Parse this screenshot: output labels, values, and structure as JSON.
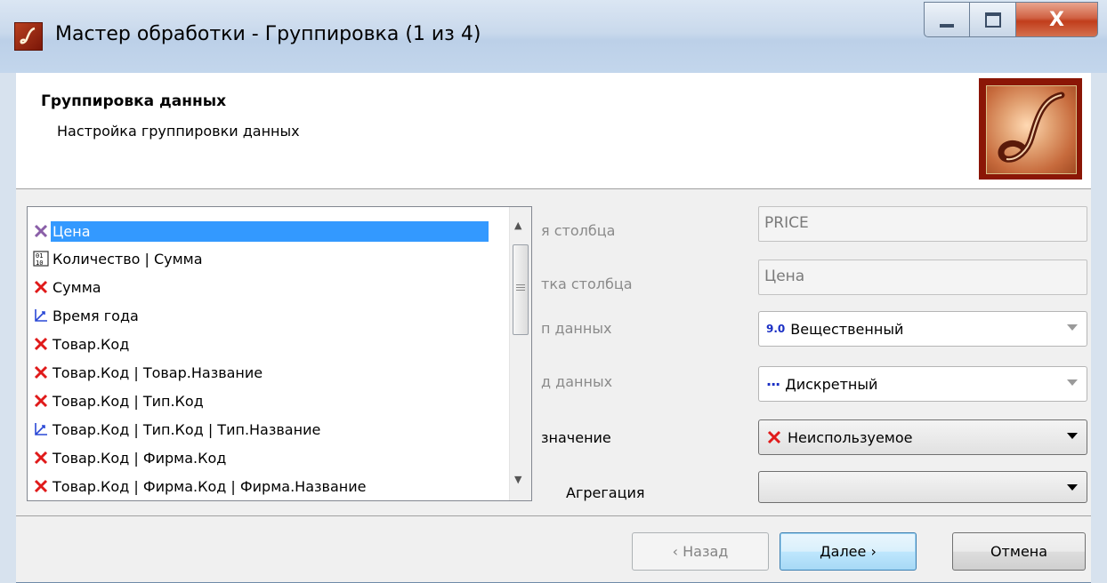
{
  "window": {
    "title": "Мастер обработки - Группировка (1 из 4)",
    "close_glyph": "X"
  },
  "header": {
    "title": "Группировка данных",
    "subtitle": "Настройка группировки данных"
  },
  "columns_list": {
    "selected_index": 0,
    "items": [
      {
        "label": "Цена",
        "icon": "x-icon"
      },
      {
        "label": "Количество | Сумма",
        "icon": "numeric-icon"
      },
      {
        "label": "Сумма",
        "icon": "x-icon"
      },
      {
        "label": "Время года",
        "icon": "axis-icon"
      },
      {
        "label": "Товар.Код",
        "icon": "x-icon"
      },
      {
        "label": "Товар.Код | Товар.Название",
        "icon": "x-icon"
      },
      {
        "label": "Товар.Код | Тип.Код",
        "icon": "x-icon"
      },
      {
        "label": "Товар.Код | Тип.Код | Тип.Название",
        "icon": "axis-icon"
      },
      {
        "label": "Товар.Код | Фирма.Код",
        "icon": "x-icon"
      },
      {
        "label": "Товар.Код | Фирма.Код | Фирма.Название",
        "icon": "x-icon"
      }
    ]
  },
  "form": {
    "column_name_label": "я столбца",
    "column_name_value": "PRICE",
    "column_caption_label": "тка столбца",
    "column_caption_value": "Цена",
    "data_type_label": "п данных",
    "data_type_badge": "9.0",
    "data_type_value": "Вещественный",
    "data_kind_label": "д данных",
    "data_kind_badge": "···",
    "data_kind_value": "Дискретный",
    "purpose_label": "значение",
    "purpose_value": "Неиспользуемое",
    "aggregation_label": "Агрегация",
    "aggregation_value": ""
  },
  "buttons": {
    "back": "‹ Назад",
    "next": "Далее ›",
    "cancel": "Отмена"
  },
  "colors": {
    "selection": "#3399ff",
    "x_icon": "#e01a1a",
    "x_icon_selected": "#8a5fa8",
    "axis_icon": "#2a48d6",
    "logo_frame": "#8b1606"
  }
}
